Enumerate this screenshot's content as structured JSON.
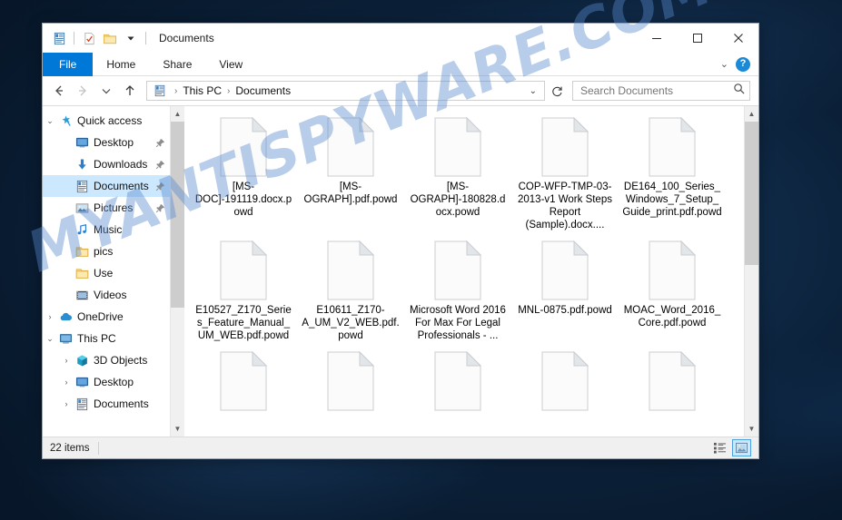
{
  "window": {
    "title": "Documents",
    "quick_access_toolbar": [
      {
        "name": "properties-icon",
        "glyph": "document-properties"
      },
      {
        "name": "new-folder-icon",
        "glyph": "folder"
      },
      {
        "name": "customize-dropdown-icon",
        "glyph": "chevron-down"
      }
    ],
    "controls": {
      "minimize": "—",
      "maximize": "□",
      "close": "✕"
    }
  },
  "ribbon": {
    "tabs": [
      {
        "label": "File",
        "active": true
      },
      {
        "label": "Home",
        "active": false
      },
      {
        "label": "Share",
        "active": false
      },
      {
        "label": "View",
        "active": false
      }
    ],
    "expand_ribbon_icon": "chevron-down-icon",
    "help_label": "?"
  },
  "address": {
    "back_icon": "←",
    "forward_icon": "→",
    "recent_icon": "∨",
    "up_icon": "↑",
    "breadcrumbs": [
      "This PC",
      "Documents"
    ],
    "separator": "›",
    "dropdown_icon": "∨",
    "refresh_icon": "↻"
  },
  "search": {
    "placeholder": "Search Documents",
    "icon": "search-icon"
  },
  "navpane": {
    "items": [
      {
        "label": "Quick access",
        "icon": "star-icon",
        "expander": "⌄",
        "indent": 0,
        "selected": false,
        "pinned": false
      },
      {
        "label": "Desktop",
        "icon": "monitor-icon",
        "expander": "",
        "indent": 1,
        "selected": false,
        "pinned": true
      },
      {
        "label": "Downloads",
        "icon": "download-icon",
        "expander": "",
        "indent": 1,
        "selected": false,
        "pinned": true
      },
      {
        "label": "Documents",
        "icon": "document-icon",
        "expander": "",
        "indent": 1,
        "selected": true,
        "pinned": true
      },
      {
        "label": "Pictures",
        "icon": "picture-icon",
        "expander": "",
        "indent": 1,
        "selected": false,
        "pinned": true
      },
      {
        "label": "Music",
        "icon": "music-icon",
        "expander": "",
        "indent": 1,
        "selected": false,
        "pinned": false
      },
      {
        "label": "pics",
        "icon": "folder-icon",
        "expander": "",
        "indent": 1,
        "selected": false,
        "pinned": false
      },
      {
        "label": "Use",
        "icon": "folder-icon",
        "expander": "",
        "indent": 1,
        "selected": false,
        "pinned": false
      },
      {
        "label": "Videos",
        "icon": "video-icon",
        "expander": "",
        "indent": 1,
        "selected": false,
        "pinned": false
      },
      {
        "label": "OneDrive",
        "icon": "cloud-icon",
        "expander": "›",
        "indent": 0,
        "selected": false,
        "pinned": false
      },
      {
        "label": "This PC",
        "icon": "pc-icon",
        "expander": "⌄",
        "indent": 0,
        "selected": false,
        "pinned": false
      },
      {
        "label": "3D Objects",
        "icon": "cube-icon",
        "expander": "›",
        "indent": 1,
        "selected": false,
        "pinned": false
      },
      {
        "label": "Desktop",
        "icon": "monitor-icon",
        "expander": "›",
        "indent": 1,
        "selected": false,
        "pinned": false
      },
      {
        "label": "Documents",
        "icon": "document-icon",
        "expander": "›",
        "indent": 1,
        "selected": false,
        "pinned": false
      }
    ]
  },
  "files": [
    {
      "name": "[MS-DOC]-191119.docx.powd",
      "icon": "blank-file-icon"
    },
    {
      "name": "[MS-OGRAPH].pdf.powd",
      "icon": "blank-file-icon"
    },
    {
      "name": "[MS-OGRAPH]-180828.docx.powd",
      "icon": "blank-file-icon"
    },
    {
      "name": "COP-WFP-TMP-03-2013-v1 Work Steps Report (Sample).docx....",
      "icon": "blank-file-icon"
    },
    {
      "name": "DE164_100_Series_Windows_7_Setup_Guide_print.pdf.powd",
      "icon": "blank-file-icon"
    },
    {
      "name": "E10527_Z170_Series_Feature_Manual_UM_WEB.pdf.powd",
      "icon": "blank-file-icon"
    },
    {
      "name": "E10611_Z170-A_UM_V2_WEB.pdf.powd",
      "icon": "blank-file-icon"
    },
    {
      "name": "Microsoft Word 2016 For Max For Legal Professionals - ...",
      "icon": "blank-file-icon"
    },
    {
      "name": "MNL-0875.pdf.powd",
      "icon": "blank-file-icon"
    },
    {
      "name": "MOAC_Word_2016_Core.pdf.powd",
      "icon": "blank-file-icon"
    },
    {
      "name": "",
      "icon": "blank-file-icon"
    },
    {
      "name": "",
      "icon": "blank-file-icon"
    },
    {
      "name": "",
      "icon": "blank-file-icon"
    },
    {
      "name": "",
      "icon": "blank-file-icon"
    },
    {
      "name": "",
      "icon": "blank-file-icon"
    }
  ],
  "statusbar": {
    "item_count": "22 items",
    "view_buttons": [
      {
        "name": "details-view-button",
        "active": false
      },
      {
        "name": "large-icons-view-button",
        "active": true
      }
    ]
  },
  "watermark": {
    "text": "MYANTISPYWARE.COM"
  },
  "colors": {
    "accent": "#0078d7",
    "selection": "#cce8ff",
    "desktop": "#0b2038",
    "watermark": "#5689ce"
  }
}
